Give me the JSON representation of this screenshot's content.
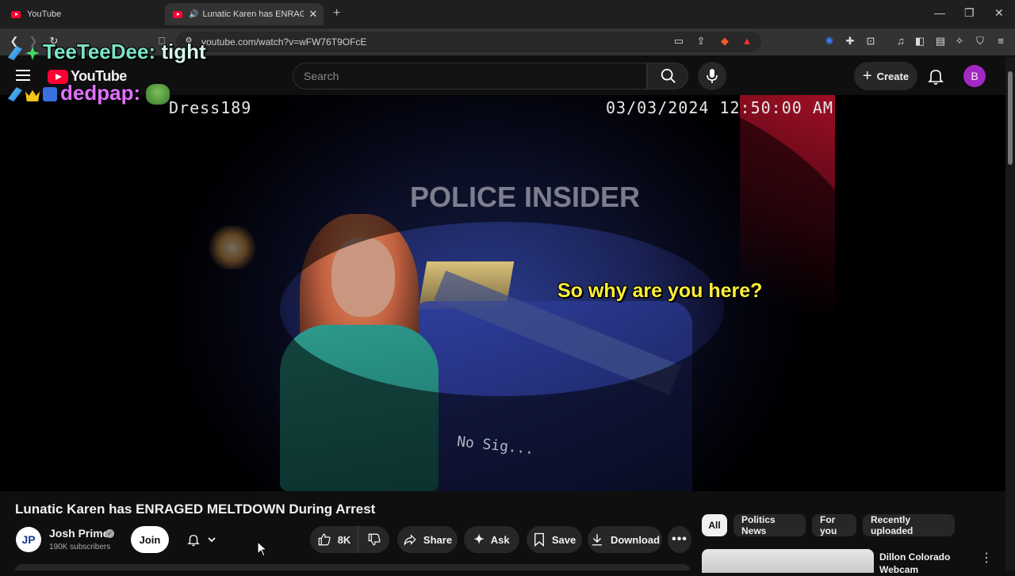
{
  "browser": {
    "tabs": [
      {
        "label": "YouTube"
      },
      {
        "label": "Lunatic Karen has ENRAGED MELTDOWN During Arrest"
      }
    ],
    "url": "youtube.com/watch?v=wFW76T9OFcE"
  },
  "overlay": {
    "chat1_name": "TeeTeeDee:",
    "chat1_msg": "tight",
    "chat2_name": "dedpap:"
  },
  "header": {
    "logo": "YouTube",
    "search_placeholder": "Search",
    "create_label": "Create",
    "avatar_letter": "B"
  },
  "video": {
    "bodycam_id": "Dress189",
    "timestamp": "03/03/2024 12:50:00 AM",
    "watermark": "POLICE INSIDER",
    "caption": "So why are you here?",
    "sign_text": "No Sig..."
  },
  "watch": {
    "title": "Lunatic Karen has ENRAGED MELTDOWN During Arrest",
    "channel": {
      "name": "Josh Prime",
      "subscribers": "190K subscribers",
      "avatar": "JP"
    },
    "join_label": "Join",
    "like_count": "8K",
    "share_label": "Share",
    "ask_label": "Ask",
    "save_label": "Save",
    "download_label": "Download"
  },
  "recommendations": {
    "chips": [
      "All",
      "Politics News",
      "For you",
      "Recently uploaded"
    ],
    "first_video_title": "Dillon Colorado Webcam"
  },
  "colors": {
    "accent": "#ff0033",
    "avatar": "#a328c4",
    "caption": "#ffef3a"
  }
}
